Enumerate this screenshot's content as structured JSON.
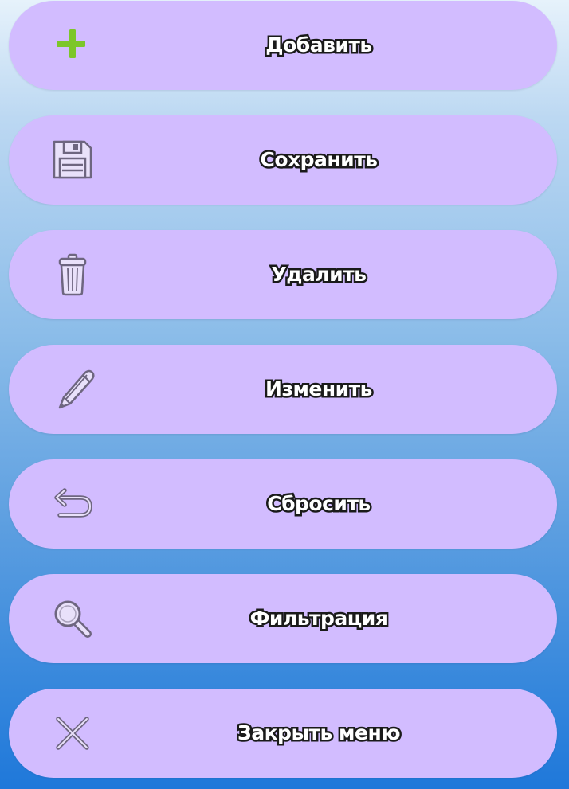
{
  "menu": {
    "items": [
      {
        "label": "Добавить",
        "icon": "plus-icon"
      },
      {
        "label": "Сохранить",
        "icon": "floppy-disk-icon"
      },
      {
        "label": "Удалить",
        "icon": "trash-icon"
      },
      {
        "label": "Изменить",
        "icon": "pencil-icon"
      },
      {
        "label": "Сбросить",
        "icon": "undo-icon"
      },
      {
        "label": "Фильтрация",
        "icon": "magnifier-icon"
      },
      {
        "label": "Закрыть меню",
        "icon": "close-icon"
      }
    ]
  },
  "colors": {
    "button_bg": "#d2bcff",
    "icon_stroke": "#6e6680",
    "plus_icon": "#7cc62a",
    "label_fill": "#ffffff",
    "label_outline": "#1a1a1a",
    "background_top": "#e6f2fb",
    "background_bottom": "#1f78da"
  }
}
